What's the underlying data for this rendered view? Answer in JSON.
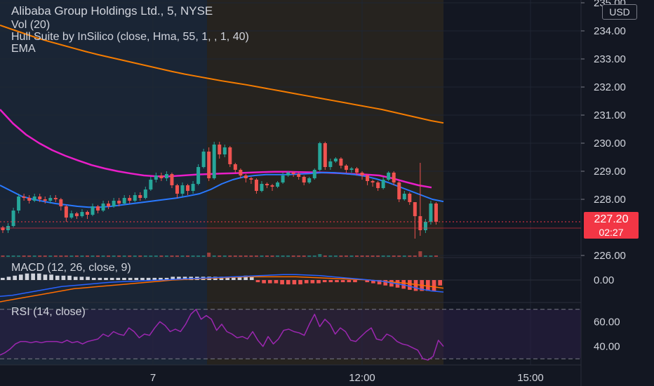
{
  "legend": {
    "title": "Alibaba Group Holdings Ltd., 5, NYSE",
    "vol": "Vol (20)",
    "hull": "Hull Suite by InSilico (close, Hma, 55, 1, , 1, 40)",
    "ema": "EMA",
    "macd": "MACD (12, 26, close, 9)",
    "rsi": "RSI (14, close)"
  },
  "currency": "USD",
  "last_price": {
    "value": "227.20",
    "countdown": "02:27"
  },
  "colors": {
    "background": "#131722",
    "session_pre": "#1a2535",
    "session_regular": "#26231f",
    "up": "#26a69a",
    "down": "#ef5350",
    "ema": "#f57c00",
    "hull": "#e91ec8",
    "ma_blue": "#2979ff",
    "macd_line": "#2962ff",
    "signal_line": "#ff6d00",
    "rsi_line": "#9c27b0",
    "rsi_band": "#2a1f45",
    "price_line": "#f23645"
  },
  "chart_data": [
    {
      "type": "candlestick",
      "pane": "price",
      "x_ticks": [
        "7",
        "12:00",
        "15:00"
      ],
      "y_ticks": [
        {
          "label": "235.00",
          "value": 235
        },
        {
          "label": "234.00",
          "value": 234
        },
        {
          "label": "233.00",
          "value": 233
        },
        {
          "label": "232.00",
          "value": 232
        },
        {
          "label": "231.00",
          "value": 231
        },
        {
          "label": "230.00",
          "value": 230
        },
        {
          "label": "229.00",
          "value": 229
        },
        {
          "label": "228.00",
          "value": 228
        },
        {
          "label": "226.00",
          "value": 226
        }
      ],
      "ylim": [
        225.95,
        235.1
      ],
      "last_price": 227.2,
      "candles": [
        [
          227.0,
          226.9,
          226.8,
          227.05
        ],
        [
          226.9,
          227.05,
          226.8,
          227.15
        ],
        [
          227.05,
          227.6,
          227.0,
          227.7
        ],
        [
          227.6,
          228.1,
          227.5,
          228.2
        ],
        [
          228.1,
          228.05,
          227.95,
          228.2
        ],
        [
          228.05,
          227.95,
          227.85,
          228.15
        ],
        [
          227.95,
          228.1,
          227.9,
          228.2
        ],
        [
          228.1,
          228.0,
          227.9,
          228.2
        ],
        [
          228.0,
          227.95,
          227.85,
          228.1
        ],
        [
          227.95,
          228.05,
          227.85,
          228.15
        ],
        [
          228.05,
          228.0,
          227.9,
          228.15
        ],
        [
          228.0,
          227.75,
          227.6,
          228.05
        ],
        [
          227.75,
          227.35,
          227.2,
          227.8
        ],
        [
          227.35,
          227.5,
          227.3,
          227.6
        ],
        [
          227.5,
          227.4,
          227.3,
          227.55
        ],
        [
          227.4,
          227.55,
          227.35,
          227.65
        ],
        [
          227.55,
          227.45,
          227.3,
          227.6
        ],
        [
          227.45,
          227.75,
          227.4,
          227.85
        ],
        [
          227.75,
          227.6,
          227.5,
          227.8
        ],
        [
          227.6,
          227.85,
          227.55,
          227.95
        ],
        [
          227.85,
          227.75,
          227.65,
          227.95
        ],
        [
          227.75,
          227.95,
          227.7,
          228.05
        ],
        [
          227.95,
          227.85,
          227.75,
          228.05
        ],
        [
          227.85,
          228.05,
          227.8,
          228.15
        ],
        [
          228.05,
          227.95,
          227.85,
          228.15
        ],
        [
          227.95,
          228.15,
          227.9,
          228.25
        ],
        [
          228.15,
          228.05,
          227.95,
          228.25
        ],
        [
          228.05,
          228.35,
          228.0,
          228.45
        ],
        [
          228.35,
          228.7,
          228.3,
          228.8
        ],
        [
          228.7,
          228.85,
          228.6,
          228.95
        ],
        [
          228.85,
          228.75,
          228.65,
          228.95
        ],
        [
          228.75,
          228.9,
          228.65,
          229.0
        ],
        [
          228.9,
          228.5,
          228.4,
          228.95
        ],
        [
          228.5,
          228.2,
          228.05,
          228.55
        ],
        [
          228.2,
          228.5,
          228.1,
          228.6
        ],
        [
          228.5,
          228.3,
          228.15,
          228.55
        ],
        [
          228.3,
          228.55,
          228.2,
          228.65
        ],
        [
          228.55,
          229.15,
          228.5,
          229.25
        ],
        [
          229.15,
          229.7,
          229.1,
          229.8
        ],
        [
          229.7,
          228.75,
          228.65,
          229.85
        ],
        [
          228.75,
          229.95,
          228.7,
          230.05
        ],
        [
          229.95,
          229.6,
          229.45,
          230.05
        ],
        [
          229.6,
          229.85,
          229.5,
          229.95
        ],
        [
          229.85,
          229.25,
          229.15,
          229.9
        ],
        [
          229.25,
          229.05,
          228.95,
          229.3
        ],
        [
          229.05,
          228.85,
          228.75,
          229.1
        ],
        [
          228.85,
          228.75,
          228.6,
          228.9
        ],
        [
          228.75,
          228.7,
          228.55,
          228.8
        ],
        [
          228.7,
          228.3,
          228.2,
          228.75
        ],
        [
          228.3,
          228.55,
          228.25,
          228.65
        ],
        [
          228.55,
          228.5,
          228.4,
          228.6
        ],
        [
          228.5,
          228.45,
          228.3,
          228.55
        ],
        [
          228.45,
          228.6,
          228.4,
          228.65
        ],
        [
          228.6,
          228.85,
          228.55,
          228.95
        ],
        [
          228.85,
          228.95,
          228.8,
          229.0
        ],
        [
          228.95,
          228.9,
          228.8,
          229.0
        ],
        [
          228.9,
          228.8,
          228.7,
          228.95
        ],
        [
          228.8,
          228.6,
          228.5,
          228.85
        ],
        [
          228.6,
          228.75,
          228.55,
          228.8
        ],
        [
          228.75,
          229.05,
          228.7,
          229.1
        ],
        [
          229.05,
          230.0,
          229.0,
          230.05
        ],
        [
          230.0,
          229.15,
          229.05,
          230.05
        ],
        [
          229.15,
          229.35,
          229.05,
          229.45
        ],
        [
          229.35,
          229.45,
          229.3,
          229.5
        ],
        [
          229.45,
          229.2,
          229.1,
          229.5
        ],
        [
          229.2,
          229.05,
          228.95,
          229.25
        ],
        [
          229.05,
          229.1,
          228.95,
          229.15
        ],
        [
          229.1,
          228.95,
          228.85,
          229.15
        ],
        [
          228.95,
          228.85,
          228.7,
          229.0
        ],
        [
          228.85,
          228.65,
          228.5,
          228.9
        ],
        [
          228.65,
          228.6,
          228.45,
          228.7
        ],
        [
          228.6,
          228.4,
          228.3,
          228.65
        ],
        [
          228.4,
          228.7,
          228.35,
          228.8
        ],
        [
          228.7,
          228.95,
          228.65,
          229.0
        ],
        [
          228.95,
          228.6,
          228.5,
          229.0
        ],
        [
          228.6,
          228.0,
          227.9,
          228.65
        ],
        [
          228.0,
          228.2,
          227.95,
          228.3
        ],
        [
          228.2,
          227.9,
          227.8,
          228.25
        ],
        [
          227.9,
          227.4,
          226.6,
          227.45
        ],
        [
          227.4,
          226.9,
          226.7,
          229.3
        ],
        [
          226.9,
          227.2,
          226.8,
          227.3
        ],
        [
          227.2,
          227.85,
          227.1,
          227.95
        ],
        [
          227.85,
          227.2,
          227.1,
          227.9
        ]
      ]
    },
    {
      "type": "line",
      "pane": "price",
      "series": [
        {
          "label": "EMA",
          "values": [
            234.2,
            234.05,
            233.9,
            233.75,
            233.62,
            233.5,
            233.38,
            233.26,
            233.15,
            233.05,
            232.95,
            232.85,
            232.75,
            232.65,
            232.55,
            232.46,
            232.38,
            232.3,
            232.22,
            232.15,
            232.08,
            232.0,
            231.92,
            231.84,
            231.76,
            231.68,
            231.6,
            231.52,
            231.44,
            231.36,
            231.28,
            231.2,
            231.1,
            231.0,
            230.9,
            230.8,
            230.72
          ]
        },
        {
          "label": "Hull",
          "values": [
            231.2,
            230.7,
            230.3,
            230.0,
            229.75,
            229.55,
            229.38,
            229.22,
            229.1,
            229.0,
            228.92,
            228.85,
            228.82,
            228.82,
            228.85,
            228.88,
            228.9,
            228.92,
            228.93,
            228.95,
            228.97,
            228.98,
            228.98,
            228.97,
            228.96,
            228.95,
            228.93,
            228.9,
            228.88,
            228.85,
            228.75,
            228.62,
            228.5,
            228.42
          ]
        },
        {
          "label": "MA",
          "values": [
            228.5,
            228.3,
            228.1,
            228.0,
            227.92,
            227.85,
            227.8,
            227.75,
            227.72,
            227.72,
            227.75,
            227.8,
            227.85,
            227.9,
            227.95,
            228.0,
            228.05,
            228.12,
            228.2,
            228.35,
            228.55,
            228.7,
            228.8,
            228.85,
            228.88,
            228.88,
            228.88,
            228.9,
            228.92,
            228.95,
            228.95,
            228.92,
            228.88,
            228.82,
            228.72,
            228.6,
            228.45,
            228.3,
            228.15,
            228.0,
            227.92
          ]
        }
      ]
    },
    {
      "type": "bar",
      "pane": "volume",
      "values": [
        1,
        1,
        1,
        1,
        1,
        1,
        1,
        1,
        1,
        1,
        1,
        1,
        1,
        1,
        1,
        1,
        1,
        1,
        1,
        1,
        1,
        1,
        1,
        1,
        1,
        1,
        1,
        1,
        1,
        1,
        1,
        1,
        1,
        1,
        1,
        1,
        1,
        1,
        1,
        3,
        1,
        1,
        1,
        1,
        1,
        1,
        1,
        1,
        1,
        1,
        1,
        1,
        1,
        1,
        1,
        1,
        1,
        1,
        1,
        1,
        2,
        1,
        1,
        1,
        1,
        1,
        1,
        1,
        1,
        1,
        1,
        1,
        1,
        1,
        1,
        1,
        1,
        1,
        1,
        4,
        1,
        1,
        1
      ]
    },
    {
      "type": "bar",
      "pane": "macd",
      "y_ticks": [
        {
          "label": "0.00",
          "value": 0
        }
      ],
      "ylim": [
        -0.2,
        0.2
      ],
      "histogram": [
        0.02,
        0.03,
        0.04,
        0.05,
        0.06,
        0.06,
        0.06,
        0.05,
        0.05,
        0.04,
        0.04,
        0.04,
        0.03,
        0.03,
        0.03,
        0.02,
        0.02,
        0.02,
        0.02,
        0.02,
        0.02,
        0.02,
        0.02,
        0.02,
        0.02,
        0.02,
        0.02,
        0.02,
        0.03,
        0.03,
        0.03,
        0.03,
        0.03,
        0.03,
        0.03,
        0.03,
        0.03,
        0.03,
        0.03,
        0.03,
        0.04,
        0.04,
        -0.02,
        -0.03,
        -0.03,
        -0.03,
        -0.04,
        -0.04,
        -0.04,
        -0.04,
        -0.03,
        -0.03,
        -0.03,
        -0.02,
        -0.02,
        -0.02,
        -0.02,
        -0.02,
        -0.02,
        0.01,
        -0.02,
        -0.03,
        -0.04,
        -0.05,
        -0.06,
        -0.07,
        -0.08,
        -0.09,
        -0.1,
        -0.1,
        -0.1,
        -0.1,
        -0.05
      ],
      "macd_line": [
        -0.15,
        -0.14,
        -0.12,
        -0.1,
        -0.08,
        -0.06,
        -0.05,
        -0.04,
        -0.03,
        -0.02,
        -0.015,
        -0.01,
        -0.005,
        0.0,
        0.005,
        0.01,
        0.015,
        0.02,
        0.025,
        0.03,
        0.035,
        0.04,
        0.045,
        0.05,
        0.05,
        0.045,
        0.04,
        0.03,
        0.02,
        0.01,
        0.0,
        -0.01,
        -0.03,
        -0.05,
        -0.08,
        -0.1,
        -0.11
      ],
      "signal_line": [
        -0.2,
        -0.18,
        -0.16,
        -0.14,
        -0.12,
        -0.1,
        -0.08,
        -0.07,
        -0.06,
        -0.05,
        -0.04,
        -0.03,
        -0.02,
        -0.01,
        0.0,
        0.005,
        0.01,
        0.015,
        0.02,
        0.025,
        0.03,
        0.03,
        0.03,
        0.03,
        0.03,
        0.025,
        0.02,
        0.015,
        0.01,
        0.005,
        0.0,
        -0.01,
        -0.02,
        -0.03,
        -0.045,
        -0.06,
        -0.075
      ]
    },
    {
      "type": "line",
      "pane": "rsi",
      "y_ticks": [
        {
          "label": "60.00",
          "value": 60
        },
        {
          "label": "40.00",
          "value": 40
        }
      ],
      "ylim": [
        25,
        75
      ],
      "band": [
        30,
        70
      ],
      "values": [
        33,
        35,
        38,
        42,
        44,
        44,
        43,
        44,
        43,
        44,
        44,
        44,
        43,
        45,
        43,
        44,
        42,
        44,
        45,
        46,
        50,
        48,
        52,
        50,
        49,
        55,
        52,
        47,
        50,
        49,
        55,
        60,
        57,
        52,
        54,
        52,
        58,
        66,
        70,
        62,
        65,
        62,
        53,
        58,
        52,
        50,
        47,
        48,
        46,
        52,
        45,
        40,
        48,
        42,
        46,
        53,
        54,
        52,
        51,
        49,
        58,
        66,
        56,
        62,
        58,
        50,
        55,
        52,
        45,
        44,
        48,
        52,
        55,
        46,
        45,
        50,
        48,
        44,
        42,
        41,
        39,
        37,
        30,
        29,
        32,
        45,
        40
      ]
    }
  ]
}
